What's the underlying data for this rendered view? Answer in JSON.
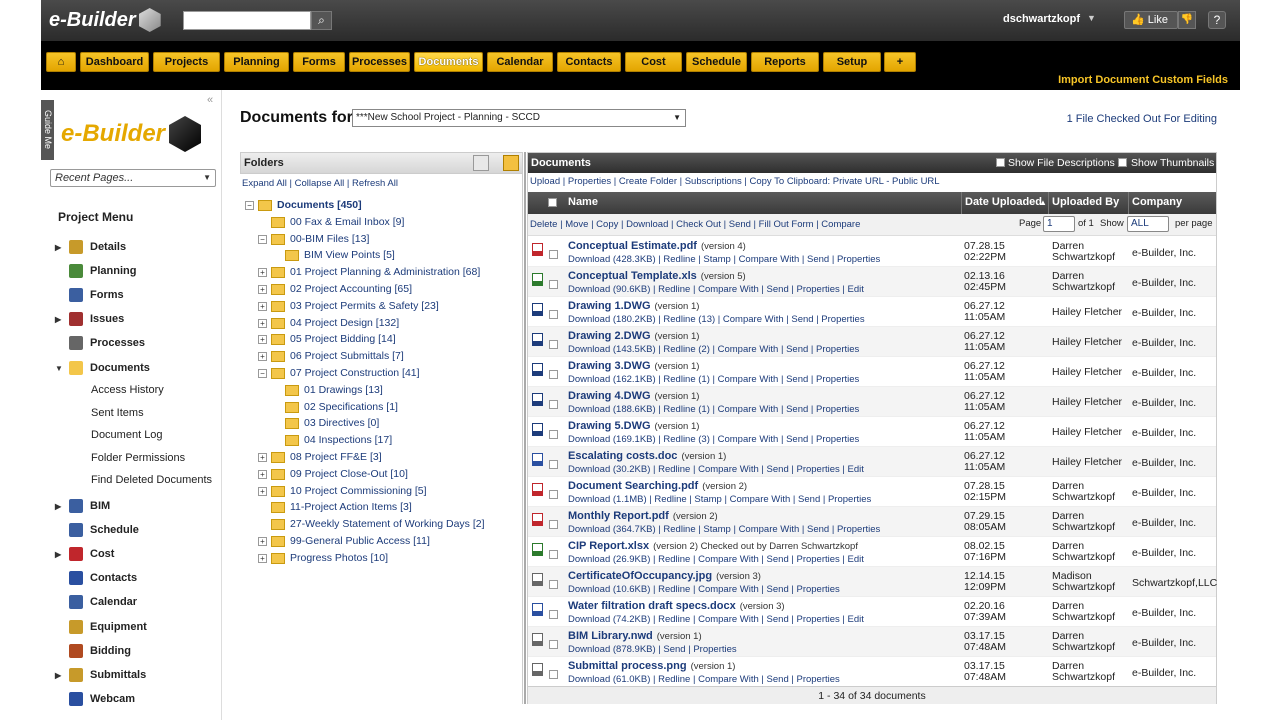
{
  "app": {
    "logo_text": "e-Builder",
    "user": "dschwartzkopf",
    "like_label": "Like",
    "help_label": "?"
  },
  "nav": {
    "tabs": [
      "Dashboard",
      "Projects",
      "Planning",
      "Forms",
      "Processes",
      "Documents",
      "Calendar",
      "Contacts",
      "Cost",
      "Schedule",
      "Reports",
      "Setup"
    ],
    "active_tab": "Documents",
    "add_label": "+",
    "import_link": "Import Document Custom Fields"
  },
  "sidebar": {
    "guide_me": "Guide Me",
    "collapse": "«",
    "logo_text": "e-Builder",
    "recent_pages": "Recent Pages...",
    "project_menu_title": "Project Menu",
    "items": [
      {
        "label": "Details",
        "icon": "details-icon",
        "arrow": "▶"
      },
      {
        "label": "Planning",
        "icon": "planning-icon",
        "arrow": ""
      },
      {
        "label": "Forms",
        "icon": "forms-icon",
        "arrow": ""
      },
      {
        "label": "Issues",
        "icon": "issues-icon",
        "arrow": "▶"
      },
      {
        "label": "Processes",
        "icon": "processes-icon",
        "arrow": ""
      },
      {
        "label": "Documents",
        "icon": "folder-icon",
        "arrow": "▼"
      }
    ],
    "documents_sub": [
      "Access History",
      "Sent Items",
      "Document Log",
      "Folder Permissions",
      "Find Deleted Documents"
    ],
    "items2": [
      {
        "label": "BIM",
        "icon": "bim-icon",
        "arrow": "▶"
      },
      {
        "label": "Schedule",
        "icon": "schedule-icon",
        "arrow": ""
      },
      {
        "label": "Cost",
        "icon": "cost-icon",
        "arrow": "▶"
      },
      {
        "label": "Contacts",
        "icon": "contacts-icon",
        "arrow": ""
      },
      {
        "label": "Calendar",
        "icon": "calendar-icon",
        "arrow": ""
      },
      {
        "label": "Equipment",
        "icon": "equipment-icon",
        "arrow": ""
      },
      {
        "label": "Bidding",
        "icon": "bidding-icon",
        "arrow": ""
      },
      {
        "label": "Submittals",
        "icon": "submittals-icon",
        "arrow": "▶"
      },
      {
        "label": "Webcam",
        "icon": "webcam-icon",
        "arrow": ""
      }
    ]
  },
  "main": {
    "title": "Documents for",
    "project_selected": "***New School Project - Planning - SCCD",
    "checked_out": "1 File Checked Out For Editing"
  },
  "folders": {
    "header": "Folders",
    "links": [
      "Expand All",
      "Collapse All",
      "Refresh All"
    ],
    "tree": [
      {
        "label": "Documents [450]",
        "level": 0,
        "box": "−",
        "bold": true
      },
      {
        "label": "00 Fax & Email Inbox [9]",
        "level": 1,
        "box": ""
      },
      {
        "label": "00-BIM Files [13]",
        "level": 1,
        "box": "−"
      },
      {
        "label": "BIM View Points [5]",
        "level": 2,
        "box": ""
      },
      {
        "label": "01 Project Planning & Administration [68]",
        "level": 1,
        "box": "+"
      },
      {
        "label": "02 Project Accounting [65]",
        "level": 1,
        "box": "+"
      },
      {
        "label": "03 Project Permits & Safety [23]",
        "level": 1,
        "box": "+"
      },
      {
        "label": "04 Project Design [132]",
        "level": 1,
        "box": "+"
      },
      {
        "label": "05 Project Bidding [14]",
        "level": 1,
        "box": "+"
      },
      {
        "label": "06 Project Submittals [7]",
        "level": 1,
        "box": "+"
      },
      {
        "label": "07 Project Construction [41]",
        "level": 1,
        "box": "−"
      },
      {
        "label": "01 Drawings [13]",
        "level": 2,
        "box": ""
      },
      {
        "label": "02 Specifications [1]",
        "level": 2,
        "box": ""
      },
      {
        "label": "03 Directives [0]",
        "level": 2,
        "box": ""
      },
      {
        "label": "04 Inspections [17]",
        "level": 2,
        "box": ""
      },
      {
        "label": "08 Project FF&E [3]",
        "level": 1,
        "box": "+"
      },
      {
        "label": "09 Project Close-Out [10]",
        "level": 1,
        "box": "+"
      },
      {
        "label": "10 Project Commissioning [5]",
        "level": 1,
        "box": "+"
      },
      {
        "label": "11-Project Action Items [3]",
        "level": 1,
        "box": ""
      },
      {
        "label": "27-Weekly Statement of Working Days [2]",
        "level": 1,
        "box": ""
      },
      {
        "label": "99-General Public Access [11]",
        "level": 1,
        "box": "+"
      },
      {
        "label": "Progress Photos [10]",
        "level": 1,
        "box": "+"
      }
    ]
  },
  "documents": {
    "header": "Documents",
    "show_desc": "Show File Descriptions",
    "show_thumbs": "Show Thumbnails",
    "top_links": "Upload | Properties | Create Folder | Subscriptions | Copy To Clipboard: Private URL - Public URL",
    "columns": [
      "Name",
      "Date Uploaded",
      "Uploaded By",
      "Company"
    ],
    "sort_indicator": "▲",
    "actions": "Delete | Move | Copy | Download | Check Out | Send | Fill Out Form | Compare",
    "page_label": "Page",
    "page_value": "1",
    "of_label": "of 1",
    "show_label": "Show",
    "show_value": "ALL",
    "per_page": "per page",
    "rows": [
      {
        "name": "Conceptual Estimate.pdf",
        "ver": "(version 4)",
        "acts": "Download (428.3KB) | Redline | Stamp | Compare With | Send | Properties",
        "date": "07.28.15",
        "time": "02:22PM",
        "by": "Darren Schwartzkopf",
        "co": "e-Builder, Inc.",
        "icon": "pdf-icon",
        "color": "#c0262c"
      },
      {
        "name": "Conceptual Template.xls",
        "ver": "(version 5)",
        "acts": "Download (90.6KB) | Redline | Compare With | Send | Properties | Edit",
        "date": "02.13.16",
        "time": "02:45PM",
        "by": "Darren Schwartzkopf",
        "co": "e-Builder, Inc.",
        "icon": "excel-icon",
        "color": "#2c7a2c"
      },
      {
        "name": "Drawing 1.DWG",
        "ver": "(version 1)",
        "acts": "Download (180.2KB) | Redline (13) | Compare With | Send | Properties",
        "date": "06.27.12",
        "time": "11:05AM",
        "by": "Hailey Fletcher",
        "co": "e-Builder, Inc.",
        "icon": "dwg-icon",
        "color": "#1c3b7a"
      },
      {
        "name": "Drawing 2.DWG",
        "ver": "(version 1)",
        "acts": "Download (143.5KB) | Redline (2) | Compare With | Send | Properties",
        "date": "06.27.12",
        "time": "11:05AM",
        "by": "Hailey Fletcher",
        "co": "e-Builder, Inc.",
        "icon": "dwg-icon",
        "color": "#1c3b7a"
      },
      {
        "name": "Drawing 3.DWG",
        "ver": "(version 1)",
        "acts": "Download (162.1KB) | Redline (1) | Compare With | Send | Properties",
        "date": "06.27.12",
        "time": "11:05AM",
        "by": "Hailey Fletcher",
        "co": "e-Builder, Inc.",
        "icon": "dwg-icon",
        "color": "#1c3b7a"
      },
      {
        "name": "Drawing 4.DWG",
        "ver": "(version 1)",
        "acts": "Download (188.6KB) | Redline (1) | Compare With | Send | Properties",
        "date": "06.27.12",
        "time": "11:05AM",
        "by": "Hailey Fletcher",
        "co": "e-Builder, Inc.",
        "icon": "dwg-icon",
        "color": "#1c3b7a"
      },
      {
        "name": "Drawing 5.DWG",
        "ver": "(version 1)",
        "acts": "Download (169.1KB) | Redline (3) | Compare With | Send | Properties",
        "date": "06.27.12",
        "time": "11:05AM",
        "by": "Hailey Fletcher",
        "co": "e-Builder, Inc.",
        "icon": "dwg-icon",
        "color": "#1c3b7a"
      },
      {
        "name": "Escalating costs.doc",
        "ver": "(version 1)",
        "acts": "Download (30.2KB) | Redline | Compare With | Send | Properties | Edit",
        "date": "06.27.12",
        "time": "11:05AM",
        "by": "Hailey Fletcher",
        "co": "e-Builder, Inc.",
        "icon": "word-icon",
        "color": "#2a4fa0"
      },
      {
        "name": "Document Searching.pdf",
        "ver": "(version 2)",
        "acts": "Download (1.1MB) | Redline | Stamp | Compare With | Send | Properties",
        "date": "07.28.15",
        "time": "02:15PM",
        "by": "Darren Schwartzkopf",
        "co": "e-Builder, Inc.",
        "icon": "pdf-icon",
        "color": "#c0262c"
      },
      {
        "name": "Monthly Report.pdf",
        "ver": "(version 2)",
        "acts": "Download (364.7KB) | Redline | Stamp | Compare With | Send | Properties",
        "date": "07.29.15",
        "time": "08:05AM",
        "by": "Darren Schwartzkopf",
        "co": "e-Builder, Inc.",
        "icon": "pdf-icon",
        "color": "#c0262c"
      },
      {
        "name": "CIP Report.xlsx",
        "ver": "(version 2)   Checked out by Darren Schwartzkopf",
        "acts": "Download (26.9KB) | Redline | Compare With | Send | Properties | Edit",
        "date": "08.02.15",
        "time": "07:16PM",
        "by": "Darren Schwartzkopf",
        "co": "e-Builder, Inc.",
        "icon": "checked-out-icon",
        "color": "#2c7a2c"
      },
      {
        "name": "CertificateOfOccupancy.jpg",
        "ver": "(version 3)",
        "acts": "Download (10.6KB) | Redline | Compare With | Send | Properties",
        "date": "12.14.15",
        "time": "12:09PM",
        "by": "Madison Schwartzkopf",
        "co": "Schwartzkopf,LLC",
        "icon": "image-icon",
        "color": "#666"
      },
      {
        "name": "Water filtration draft specs.docx",
        "ver": "(version 3)",
        "acts": "Download (74.2KB) | Redline | Compare With | Send | Properties | Edit",
        "date": "02.20.16",
        "time": "07:39AM",
        "by": "Darren Schwartzkopf",
        "co": "e-Builder, Inc.",
        "icon": "word-icon",
        "color": "#2a4fa0"
      },
      {
        "name": "BIM Library.nwd",
        "ver": "(version 1)",
        "acts": "Download (878.9KB) | Send | Properties",
        "date": "03.17.15",
        "time": "07:48AM",
        "by": "Darren Schwartzkopf",
        "co": "e-Builder, Inc.",
        "icon": "file-icon",
        "color": "#666"
      },
      {
        "name": "Submittal process.png",
        "ver": "(version 1)",
        "acts": "Download (61.0KB) | Redline | Compare With | Send | Properties",
        "date": "03.17.15",
        "time": "07:48AM",
        "by": "Darren Schwartzkopf",
        "co": "e-Builder, Inc.",
        "icon": "image-icon",
        "color": "#666"
      }
    ],
    "footer": "1 - 34 of 34 documents"
  }
}
